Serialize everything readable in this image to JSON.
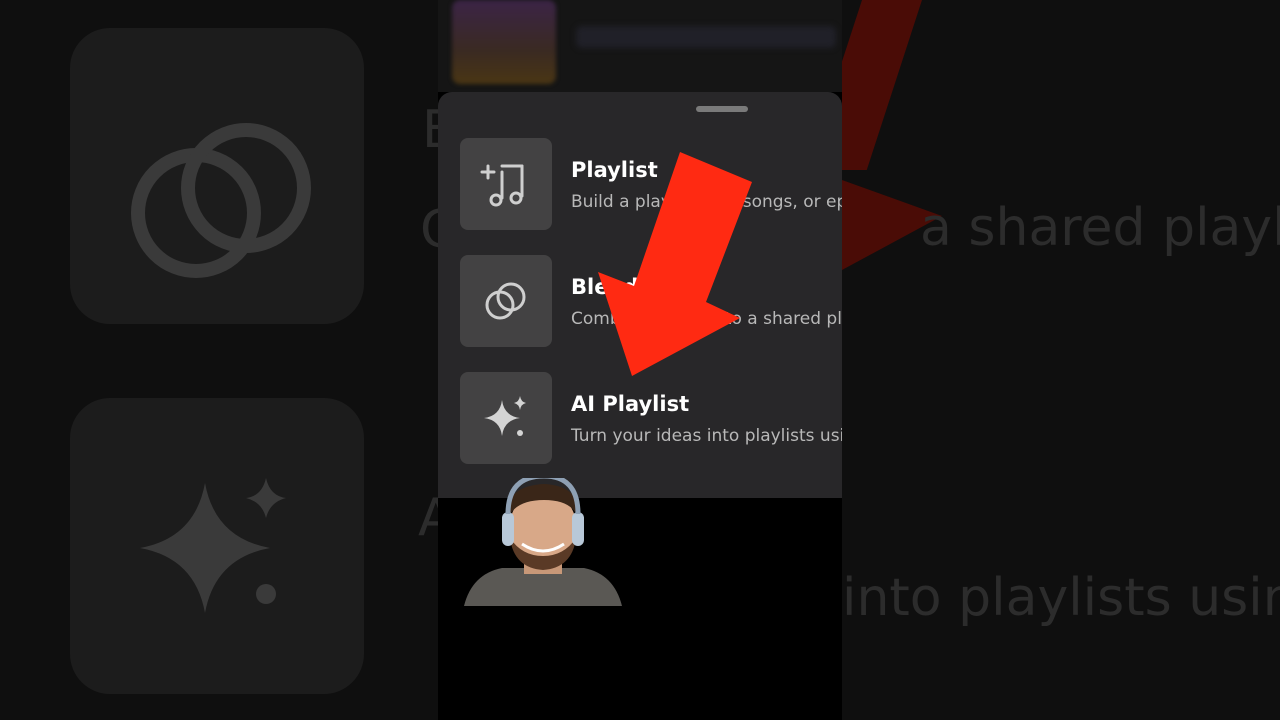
{
  "sheet": {
    "items": [
      {
        "title": "Playlist",
        "subtitle": "Build a playlist with songs, or episodes",
        "icon": "music-note-plus-icon"
      },
      {
        "title": "Blend",
        "subtitle": "Combine tastes into a shared playlist",
        "icon": "blend-circles-icon"
      },
      {
        "title": "AI Playlist",
        "subtitle": "Turn your ideas into playlists using AI",
        "icon": "sparkle-icon"
      }
    ]
  },
  "background": {
    "blend_fragment": "a shared playl",
    "ai_fragment": "into playlists usin"
  },
  "colors": {
    "sheet_bg": "#282729",
    "icon_tile": "#434243",
    "arrow": "#ff2a12"
  }
}
